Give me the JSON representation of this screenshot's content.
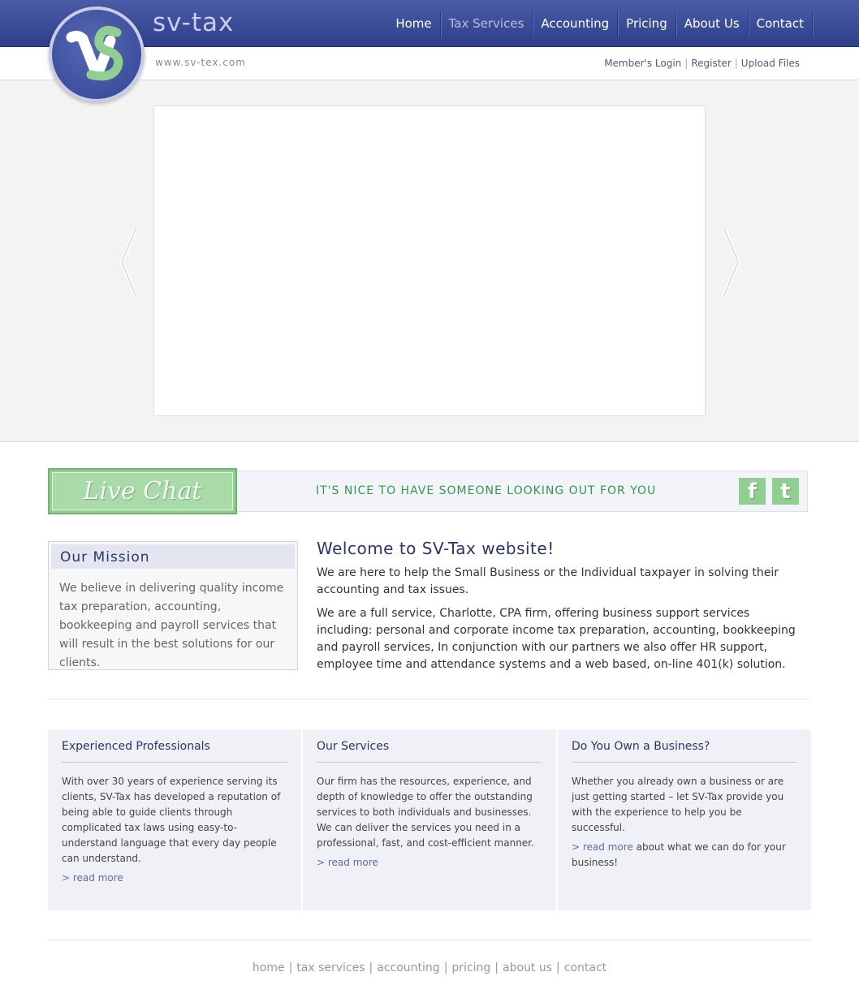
{
  "header": {
    "brand": "sv-tax",
    "url": "www.sv-tex.com",
    "nav": [
      "Home",
      "Tax Services",
      "Accounting",
      "Pricing",
      "About Us",
      "Contact"
    ],
    "active_nav": "Tax Services",
    "member_links": [
      "Member's Login",
      "Register",
      "Upload Files"
    ]
  },
  "livechat": {
    "button_label": "Live Chat",
    "tagline": "IT'S NICE TO HAVE SOMEONE LOOKING OUT FOR YOU",
    "facebook_glyph": "f",
    "twitter_glyph": "t"
  },
  "mission": {
    "title": "Our Mission",
    "text": "We believe in delivering quality income tax preparation, accounting, bookkeeping and payroll services that will result in the best solutions for our clients."
  },
  "welcome": {
    "title": "Welcome to SV-Tax website!",
    "para1": "We are here to help the Small Business or the Individual taxpayer in solving their accounting and tax issues.",
    "para2": "We are a full service, Charlotte, CPA firm, offering business support services including: personal and corporate income tax preparation, accounting, bookkeeping and payroll services, In conjunction with our partners we also offer HR support, employee time and attendance systems and a web based, on-line 401(k) solution."
  },
  "boxes": [
    {
      "title": "Experienced Professionals",
      "text": "With over 30 years of experience serving its clients, SV-Tax has developed a reputation of being able to guide clients through complicated tax laws using easy-to-understand language that every day people can understand.",
      "more": "> read more",
      "more_suffix": ""
    },
    {
      "title": "Our Services",
      "text": "Our firm has the resources, experience, and depth of knowledge to offer the outstanding services to both individuals and businesses. We can deliver the services you need in a professional, fast, and cost-efficient manner.",
      "more": "> read more",
      "more_suffix": ""
    },
    {
      "title": "Do You Own a Business?",
      "text": "Whether you already own a business or are just getting started – let SV-Tax provide you with the experience to help you be successful.",
      "more": "> read more",
      "more_suffix": " about what we can do for your business!"
    }
  ],
  "footer": {
    "links": [
      "home",
      "tax services",
      "accounting",
      "pricing",
      "about us",
      "contact"
    ]
  },
  "icons": {
    "slider_prev": "chevron-left-icon",
    "slider_next": "chevron-right-icon"
  },
  "colors": {
    "header": "#34459a",
    "accent_green": "#8fcf8f",
    "title_blue": "#2a3570"
  }
}
